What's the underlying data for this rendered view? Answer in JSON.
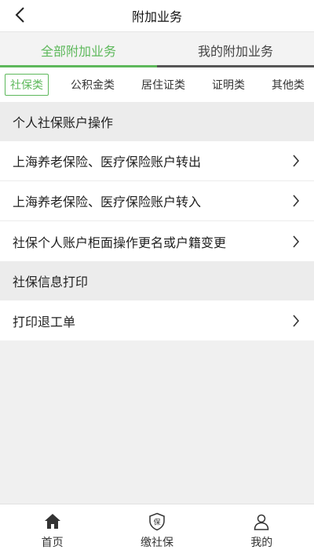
{
  "header": {
    "title": "附加业务"
  },
  "tabs": [
    {
      "label": "全部附加业务",
      "active": true
    },
    {
      "label": "我的附加业务",
      "active": false
    }
  ],
  "categories": [
    {
      "label": "社保类",
      "active": true
    },
    {
      "label": "公积金类",
      "active": false
    },
    {
      "label": "居住证类",
      "active": false
    },
    {
      "label": "证明类",
      "active": false
    },
    {
      "label": "其他类",
      "active": false
    }
  ],
  "sections": [
    {
      "title": "个人社保账户操作",
      "items": [
        "上海养老保险、医疗保险账户转出",
        "上海养老保险、医疗保险账户转入",
        "社保个人账户柜面操作更名或户籍变更"
      ]
    },
    {
      "title": "社保信息打印",
      "items": [
        "打印退工单"
      ]
    }
  ],
  "bottom_nav": [
    {
      "label": "首页",
      "icon": "home-icon"
    },
    {
      "label": "缴社保",
      "icon": "shield-icon",
      "badge_char": "保"
    },
    {
      "label": "我的",
      "icon": "user-icon"
    }
  ],
  "colors": {
    "accent": "#5db85b",
    "section_bg": "#ececec"
  }
}
